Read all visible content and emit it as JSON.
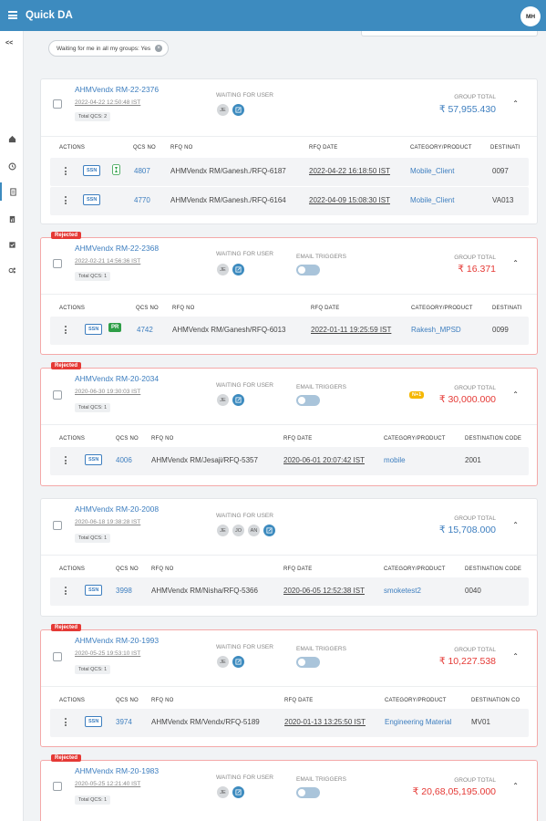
{
  "app": {
    "title": "Quick DA",
    "user_initials": "MH",
    "collapse_label": "<<"
  },
  "filter": {
    "chip_label": "Waiting for me in all my groups: Yes",
    "chip_remove": "×"
  },
  "labels": {
    "waiting_for_user": "WAITING FOR USER",
    "email_triggers": "EMAIL TRIGGERS",
    "group_total": "GROUP TOTAL",
    "rejected": "Rejected",
    "ssn": "SSN",
    "pr": "PR"
  },
  "sidebar": {
    "icons": [
      "dashboard-icon",
      "history-icon",
      "document-icon",
      "report-icon",
      "checklist-icon",
      "settings-icon"
    ]
  },
  "cards": [
    {
      "name": "AHMVendx RM-22-2376",
      "date": "2022-04-22 12:50:48 IST",
      "qcs": "Total QCS: 2",
      "avatars": [
        "JE"
      ],
      "group_total": "₹ 57,955.430",
      "rejected": false,
      "headers": [
        "ACTIONS",
        "QCS NO",
        "RFQ NO",
        "RFQ DATE",
        "CATEGORY/PRODUCT",
        "DESTINATI"
      ],
      "rows": [
        {
          "qcs_no": "4807",
          "rfq_no": "AHMVendx RM/Ganesh./RFQ-6187",
          "rfq_date": "2022-04-22 16:18:50 IST",
          "category": "Mobile_Client",
          "destination": "0097"
        },
        {
          "qcs_no": "4770",
          "rfq_no": "AHMVendx RM/Ganesh./RFQ-6164",
          "rfq_date": "2022-04-09 15:08:30 IST",
          "category": "Mobile_Client",
          "destination": "VA013"
        }
      ]
    },
    {
      "name": "AHMVendx RM-22-2368",
      "date": "2022-02-21 14:56:36 IST",
      "qcs": "Total QCS: 1",
      "avatars": [
        "JE"
      ],
      "group_total": "₹ 16.371",
      "rejected": true,
      "headers": [
        "ACTIONS",
        "QCS NO",
        "RFQ NO",
        "RFQ DATE",
        "CATEGORY/PRODUCT",
        "DESTINATI"
      ],
      "rows": [
        {
          "qcs_no": "4742",
          "rfq_no": "AHMVendx RM/Ganesh/RFQ-6013",
          "rfq_date": "2022-01-11 19:25:59 IST",
          "category": "Rakesh_MPSD",
          "destination": "0099"
        }
      ]
    },
    {
      "name": "AHMVendx RM-20-2034",
      "date": "2020-06-30 19:30:03 IST",
      "qcs": "Total QCS: 1",
      "avatars": [
        "JE"
      ],
      "group_total": "₹ 30,000.000",
      "rejected": true,
      "badge": "N+1",
      "headers": [
        "ACTIONS",
        "QCS NO",
        "RFQ NO",
        "RFQ DATE",
        "CATEGORY/PRODUCT",
        "DESTINATION CODE"
      ],
      "rows": [
        {
          "qcs_no": "4006",
          "rfq_no": "AHMVendx RM/Jesaji/RFQ-5357",
          "rfq_date": "2020-06-01 20:07:42 IST",
          "category": "mobile",
          "destination": "2001"
        }
      ]
    },
    {
      "name": "AHMVendx RM-20-2008",
      "date": "2020-06-18 19:38:28 IST",
      "qcs": "Total QCS: 1",
      "avatars": [
        "JE",
        "JO",
        "AN"
      ],
      "group_total": "₹ 15,708.000",
      "rejected": false,
      "headers": [
        "ACTIONS",
        "QCS NO",
        "RFQ NO",
        "RFQ DATE",
        "CATEGORY/PRODUCT",
        "DESTINATION CODE"
      ],
      "rows": [
        {
          "qcs_no": "3998",
          "rfq_no": "AHMVendx RM/Nisha/RFQ-5366",
          "rfq_date": "2020-06-05 12:52:38 IST",
          "category": "smoketest2",
          "destination": "0040"
        }
      ]
    },
    {
      "name": "AHMVendx RM-20-1993",
      "date": "2020-05-25 19:53:10 IST",
      "qcs": "Total QCS: 1",
      "avatars": [
        "JE"
      ],
      "group_total": "₹ 10,227.538",
      "rejected": true,
      "headers": [
        "ACTIONS",
        "QCS NO",
        "RFQ NO",
        "RFQ DATE",
        "CATEGORY/PRODUCT",
        "DESTINATION CO"
      ],
      "rows": [
        {
          "qcs_no": "3974",
          "rfq_no": "AHMVendx RM/Vendx/RFQ-5189",
          "rfq_date": "2020-01-13 13:25:50 IST",
          "category": "Engineering Material",
          "destination": "MV01"
        }
      ]
    },
    {
      "name": "AHMVendx RM-20-1983",
      "date": "2020-05-25 12:21:40 IST",
      "qcs": "Total QCS: 1",
      "avatars": [
        "JE"
      ],
      "group_total": "₹ 20,68,05,195.000",
      "rejected": true
    }
  ]
}
